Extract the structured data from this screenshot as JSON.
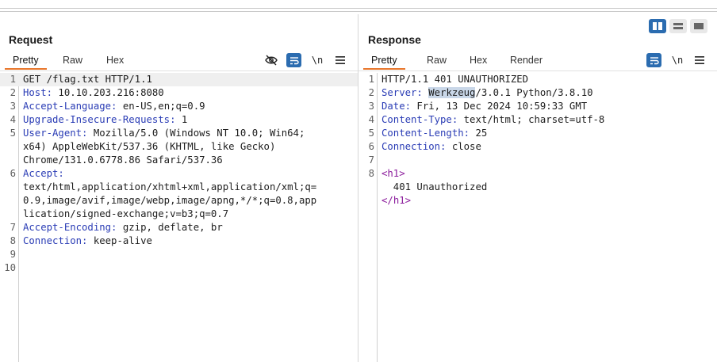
{
  "request": {
    "title": "Request",
    "tabs": [
      "Pretty",
      "Raw",
      "Hex"
    ],
    "tools": {
      "newline": "\\n"
    },
    "lines": [
      {
        "n": "1",
        "parts": [
          {
            "t": "GET /flag.txt HTTP/1.1"
          }
        ]
      },
      {
        "n": "2",
        "parts": [
          {
            "t": "Host:",
            "k": true
          },
          {
            "t": " 10.10.203.216:8080"
          }
        ]
      },
      {
        "n": "3",
        "parts": [
          {
            "t": "Accept-Language:",
            "k": true
          },
          {
            "t": " en-US,en;q=0.9"
          }
        ]
      },
      {
        "n": "4",
        "parts": [
          {
            "t": "Upgrade-Insecure-Requests:",
            "k": true
          },
          {
            "t": " 1"
          }
        ]
      },
      {
        "n": "5",
        "parts": [
          {
            "t": "User-Agent:",
            "k": true
          },
          {
            "t": " Mozilla/5.0 (Windows NT 10.0; Win64;"
          }
        ]
      },
      {
        "n": "",
        "parts": [
          {
            "t": "x64) AppleWebKit/537.36 (KHTML, like Gecko)"
          }
        ]
      },
      {
        "n": "",
        "parts": [
          {
            "t": "Chrome/131.0.6778.86 Safari/537.36"
          }
        ]
      },
      {
        "n": "6",
        "parts": [
          {
            "t": "Accept:",
            "k": true
          }
        ]
      },
      {
        "n": "",
        "parts": [
          {
            "t": "text/html,application/xhtml+xml,application/xml;q="
          }
        ]
      },
      {
        "n": "",
        "parts": [
          {
            "t": "0.9,image/avif,image/webp,image/apng,*/*;q=0.8,app"
          }
        ]
      },
      {
        "n": "",
        "parts": [
          {
            "t": "lication/signed-exchange;v=b3;q=0.7"
          }
        ]
      },
      {
        "n": "7",
        "parts": [
          {
            "t": "Accept-Encoding:",
            "k": true
          },
          {
            "t": " gzip, deflate, br"
          }
        ]
      },
      {
        "n": "8",
        "parts": [
          {
            "t": "Connection:",
            "k": true
          },
          {
            "t": " keep-alive"
          }
        ]
      },
      {
        "n": "9",
        "parts": []
      },
      {
        "n": "10",
        "parts": []
      }
    ]
  },
  "response": {
    "title": "Response",
    "tabs": [
      "Pretty",
      "Raw",
      "Hex",
      "Render"
    ],
    "tools": {
      "newline": "\\n"
    },
    "lines": [
      {
        "n": "1",
        "parts": [
          {
            "t": "HTTP/1.1 401 UNAUTHORIZED"
          }
        ]
      },
      {
        "n": "2",
        "parts": [
          {
            "t": "Server:",
            "k": true
          },
          {
            "t": " "
          },
          {
            "t": "Werkzeug",
            "sel": true
          },
          {
            "t": "/3.0.1 Python/3.8.10"
          }
        ]
      },
      {
        "n": "3",
        "parts": [
          {
            "t": "Date:",
            "k": true
          },
          {
            "t": " Fri, 13 Dec 2024 10:59:33 GMT"
          }
        ]
      },
      {
        "n": "4",
        "parts": [
          {
            "t": "Content-Type:",
            "k": true
          },
          {
            "t": " text/html; charset=utf-8"
          }
        ]
      },
      {
        "n": "5",
        "parts": [
          {
            "t": "Content-Length:",
            "k": true
          },
          {
            "t": " 25"
          }
        ]
      },
      {
        "n": "6",
        "parts": [
          {
            "t": "Connection:",
            "k": true
          },
          {
            "t": " close"
          }
        ]
      },
      {
        "n": "7",
        "parts": []
      },
      {
        "n": "8",
        "parts": [
          {
            "t": "<",
            "tag": true
          },
          {
            "t": "h1",
            "tag": true
          },
          {
            "t": ">",
            "tag": true
          }
        ]
      },
      {
        "n": "",
        "parts": [
          {
            "t": "  401 Unauthorized"
          }
        ]
      },
      {
        "n": "",
        "parts": [
          {
            "t": "</",
            "tag": true
          },
          {
            "t": "h1",
            "tag": true
          },
          {
            "t": ">",
            "tag": true
          }
        ]
      }
    ]
  },
  "colors": {
    "accent": "#e8762b",
    "header_key": "#2a3cb5",
    "tag": "#8a1a9b",
    "button_blue": "#2b6cb0"
  }
}
